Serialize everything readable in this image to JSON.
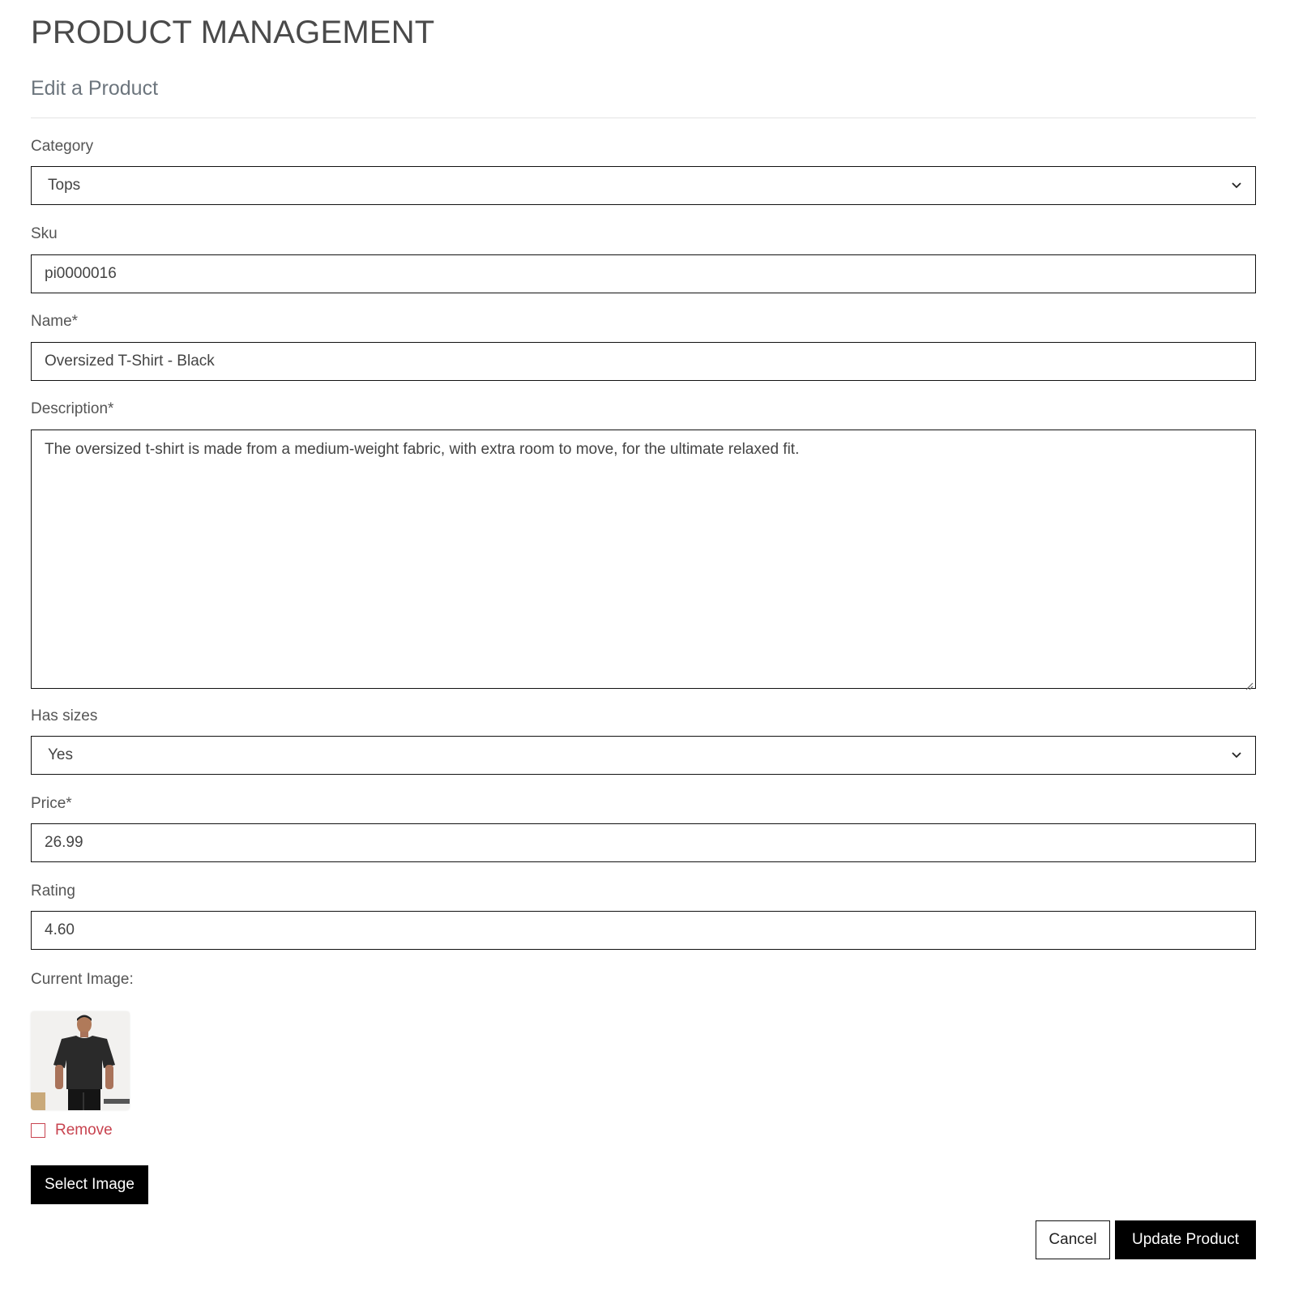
{
  "page": {
    "title": "PRODUCT MANAGEMENT",
    "subtitle": "Edit a Product"
  },
  "form": {
    "category": {
      "label": "Category",
      "value": "Tops"
    },
    "sku": {
      "label": "Sku",
      "value": "pi0000016"
    },
    "name": {
      "label": "Name*",
      "value": "Oversized T-Shirt - Black"
    },
    "description": {
      "label": "Description*",
      "value": "The oversized t-shirt is made from a medium-weight fabric, with extra room to move, for the ultimate relaxed fit."
    },
    "has_sizes": {
      "label": "Has sizes",
      "value": "Yes"
    },
    "price": {
      "label": "Price*",
      "value": "26.99"
    },
    "rating": {
      "label": "Rating",
      "value": "4.60"
    },
    "image": {
      "label": "Current Image:",
      "remove_label": "Remove",
      "remove_checked": false,
      "select_label": "Select Image"
    }
  },
  "actions": {
    "cancel_label": "Cancel",
    "update_label": "Update Product"
  },
  "icons": {
    "select_arrow": "chevron-down-icon",
    "resize": "resize-handle-icon"
  },
  "colors": {
    "primary": "#000000",
    "danger": "#c8434f",
    "text": "#555555",
    "border": "#111111"
  }
}
